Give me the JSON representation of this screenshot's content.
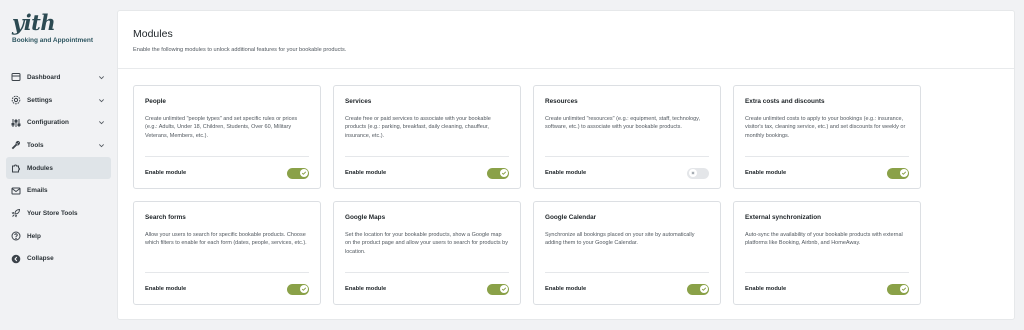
{
  "brand": {
    "logo": "yith",
    "name": "Booking and Appointment"
  },
  "sidebar": {
    "items": [
      {
        "label": "Dashboard",
        "icon": "dashboard-icon",
        "chevron": true,
        "active": false
      },
      {
        "label": "Settings",
        "icon": "gear-icon",
        "chevron": true,
        "active": false
      },
      {
        "label": "Configuration",
        "icon": "sliders-icon",
        "chevron": true,
        "active": false
      },
      {
        "label": "Tools",
        "icon": "wrench-icon",
        "chevron": true,
        "active": false
      },
      {
        "label": "Modules",
        "icon": "puzzle-icon",
        "chevron": false,
        "active": true
      },
      {
        "label": "Emails",
        "icon": "envelope-icon",
        "chevron": false,
        "active": false
      },
      {
        "label": "Your Store Tools",
        "icon": "rocket-icon",
        "chevron": false,
        "active": false
      },
      {
        "label": "Help",
        "icon": "help-icon",
        "chevron": false,
        "active": false
      },
      {
        "label": "Collapse",
        "icon": "collapse-icon",
        "chevron": false,
        "active": false
      }
    ]
  },
  "header": {
    "title": "Modules",
    "subtitle": "Enable the following modules to unlock additional features for your bookable products."
  },
  "modules": [
    {
      "title": "People",
      "description": "Create unlimited \"people types\" and set specific rules or prices (e.g.: Adults, Under 18, Children, Students, Over 60, Military Veterans, Members, etc.).",
      "enable_label": "Enable module",
      "enabled": true
    },
    {
      "title": "Services",
      "description": "Create free or paid services to associate with your bookable products (e.g.: parking, breakfast, daily cleaning, chauffeur, insurance, etc.).",
      "enable_label": "Enable module",
      "enabled": true
    },
    {
      "title": "Resources",
      "description": "Create unlimited \"resources\" (e.g.: equipment, staff, technology, software, etc.) to associate with your bookable products.",
      "enable_label": "Enable module",
      "enabled": false
    },
    {
      "title": "Extra costs and discounts",
      "description": "Create unlimited costs to apply to your bookings (e.g.: insurance, visitor's tax, cleaning service, etc.) and set discounts for weekly or monthly bookings.",
      "enable_label": "Enable module",
      "enabled": true
    },
    {
      "title": "Search forms",
      "description": "Allow your users to search for specific bookable products. Choose which filters to enable for each form (dates, people, services, etc.).",
      "enable_label": "Enable module",
      "enabled": true
    },
    {
      "title": "Google Maps",
      "description": "Set the location for your bookable products, show a Google map on the product page and allow your users to search for products by location.",
      "enable_label": "Enable module",
      "enabled": true
    },
    {
      "title": "Google Calendar",
      "description": "Synchronize all bookings placed on your site by automatically adding them to your Google Calendar.",
      "enable_label": "Enable module",
      "enabled": true
    },
    {
      "title": "External synchronization",
      "description": "Auto-sync the availability of your bookable products with external platforms like Booking, Airbnb, and HomeAway.",
      "enable_label": "Enable module",
      "enabled": true
    }
  ],
  "colors": {
    "toggle_on": "#8aa148",
    "toggle_off": "#e4e6e9",
    "active_nav": "#dfe4e8",
    "brand": "#2c4a52"
  }
}
